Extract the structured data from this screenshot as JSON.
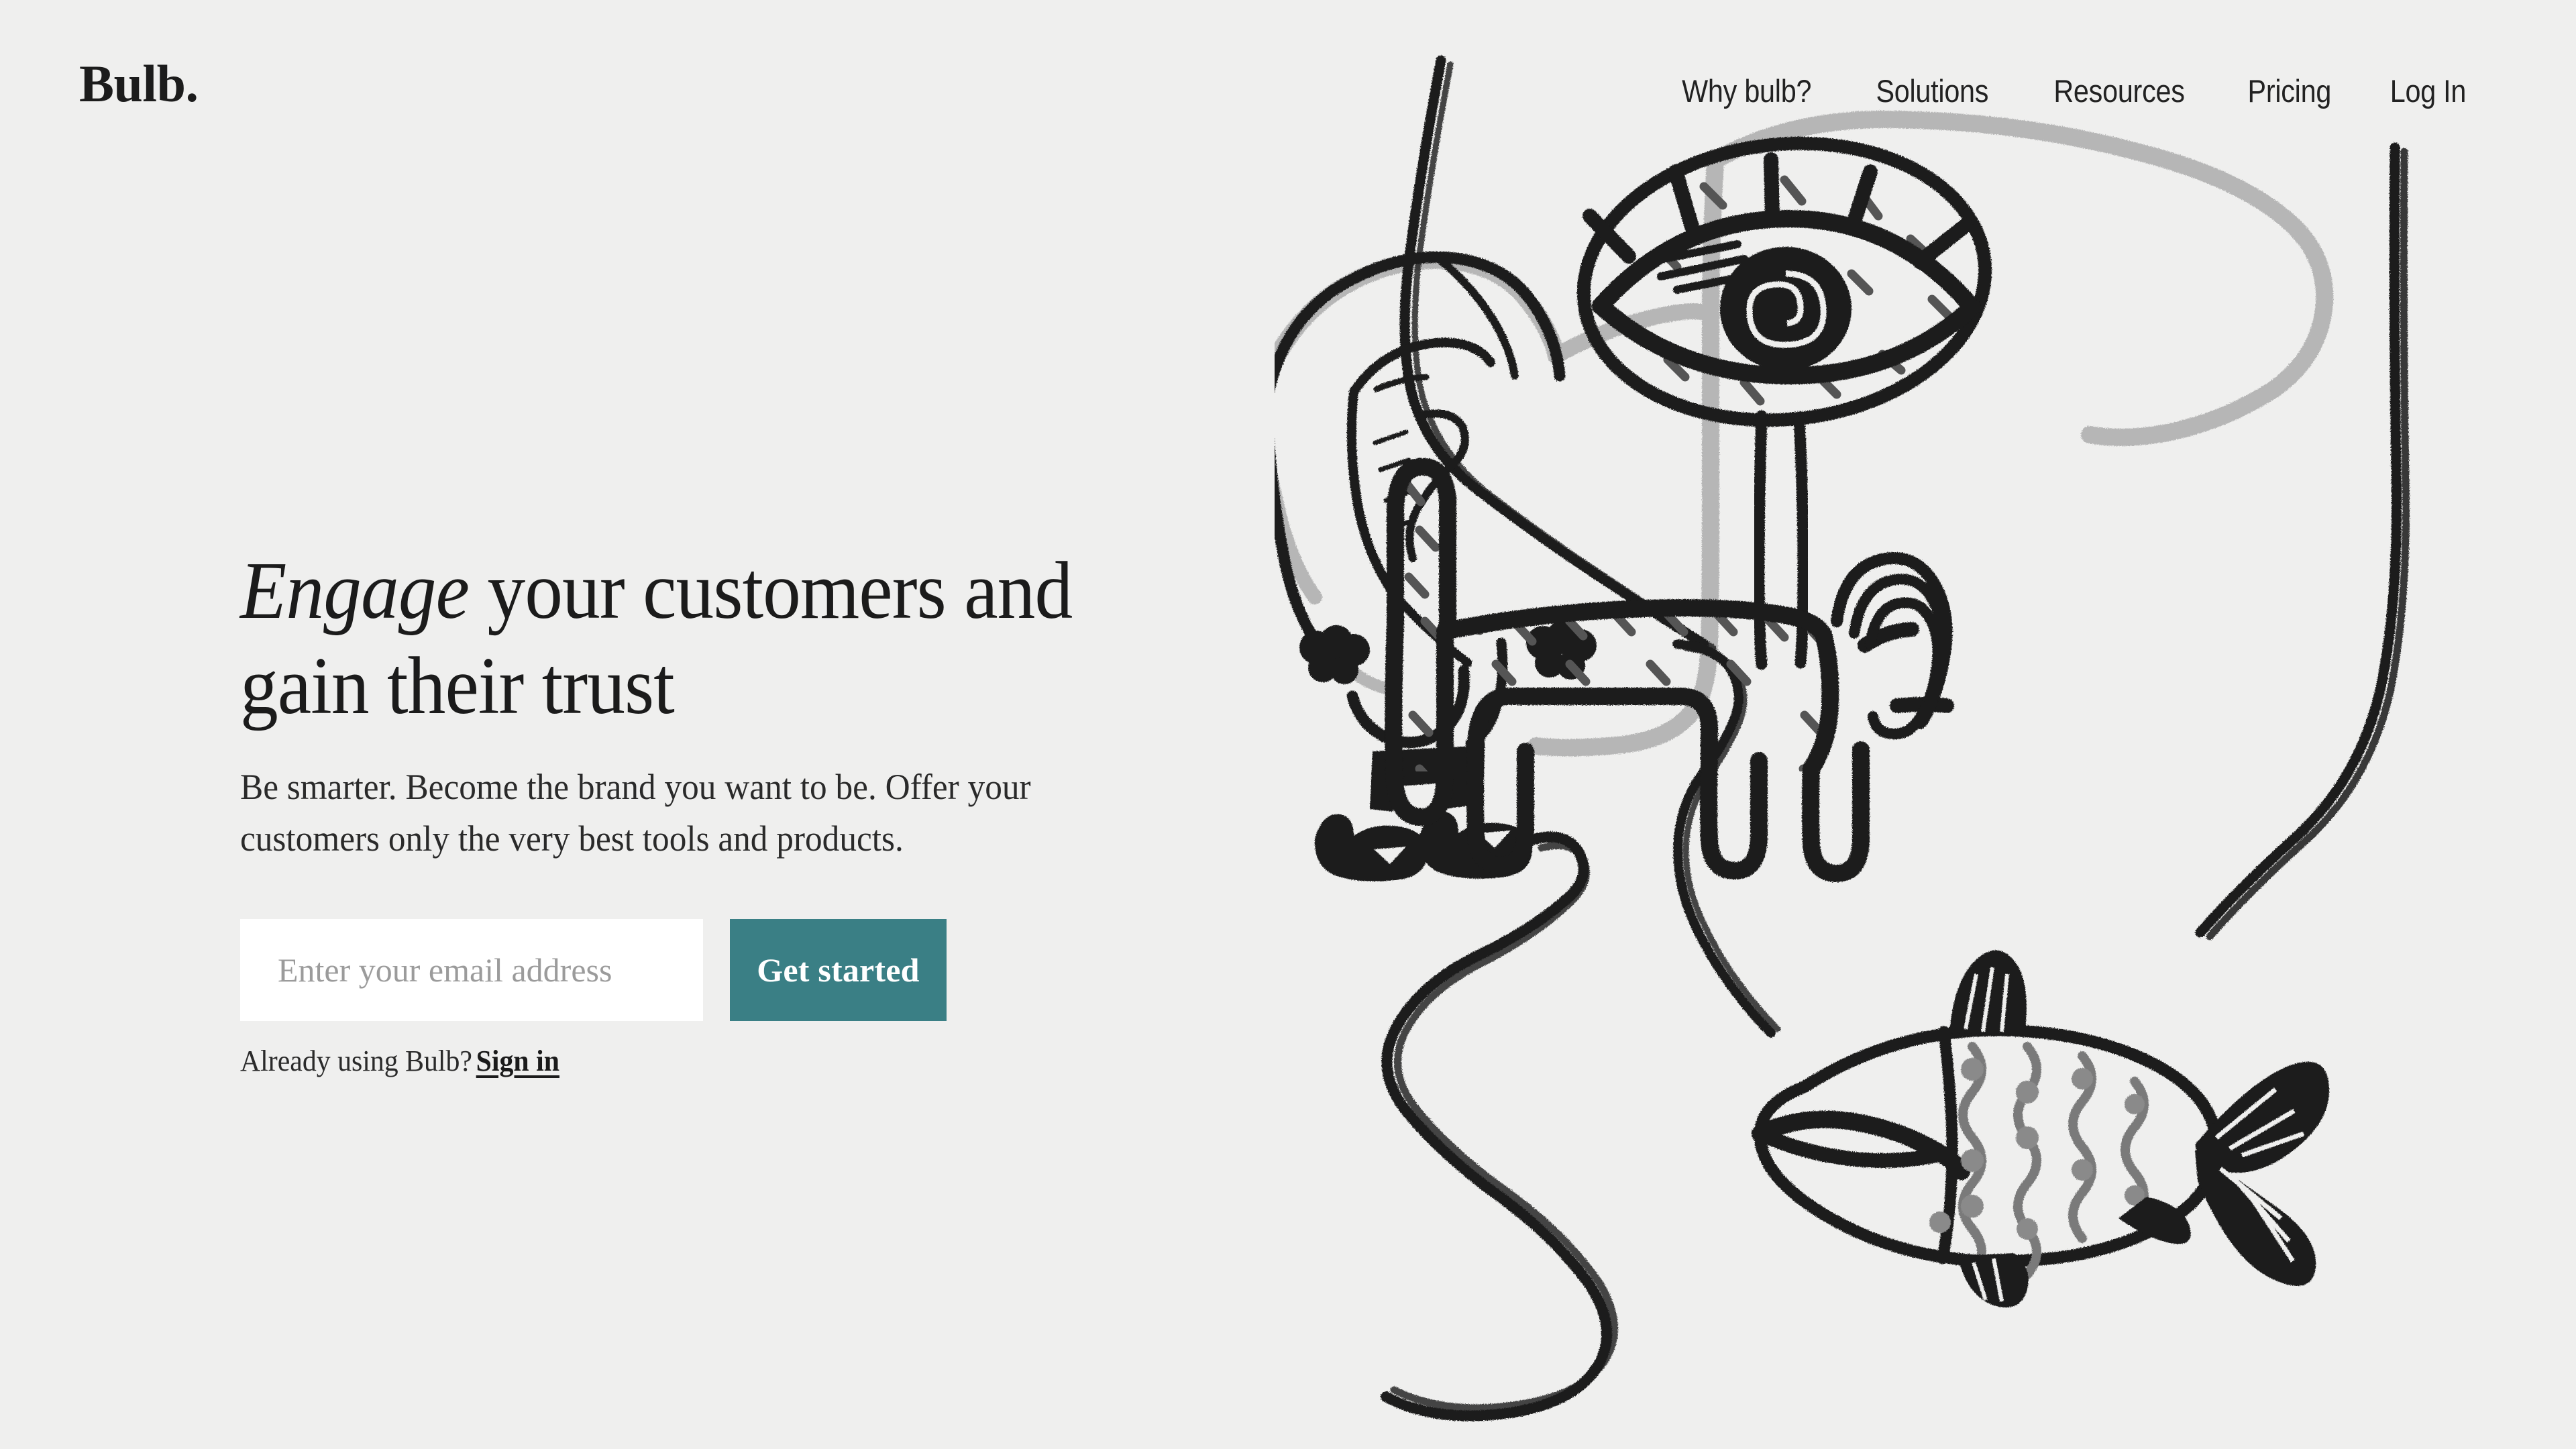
{
  "brand": {
    "logo_text": "Bulb."
  },
  "nav": {
    "items": [
      {
        "label": "Why bulb?"
      },
      {
        "label": "Solutions"
      },
      {
        "label": "Resources"
      },
      {
        "label": "Pricing"
      },
      {
        "label": "Log In"
      }
    ]
  },
  "hero": {
    "headline_italic": "Engage",
    "headline_rest": " your customers and gain their trust",
    "subtext": "Be smarter. Become the brand you want to be. Offer your customers only the very best tools and products."
  },
  "form": {
    "email_placeholder": "Enter your email address",
    "email_value": "",
    "submit_label": "Get started"
  },
  "signin": {
    "prompt": "Already using Bulb?",
    "link_label": "Sign in"
  },
  "colors": {
    "background": "#efefee",
    "accent_teal": "#3a7f85",
    "ink_black": "#1b1b1b",
    "ink_gray": "#b3b3b3",
    "dash_gray": "#555555",
    "placeholder_gray": "#9b9b9b",
    "input_white": "#ffffff"
  },
  "illustration": {
    "name": "abstract-face-line-art",
    "elements": [
      "profile-contour-line",
      "ear",
      "nostril-blobs",
      "lips-as-fish",
      "eye-with-spiral-iris",
      "speckled-animal",
      "gray-contour-line"
    ]
  }
}
